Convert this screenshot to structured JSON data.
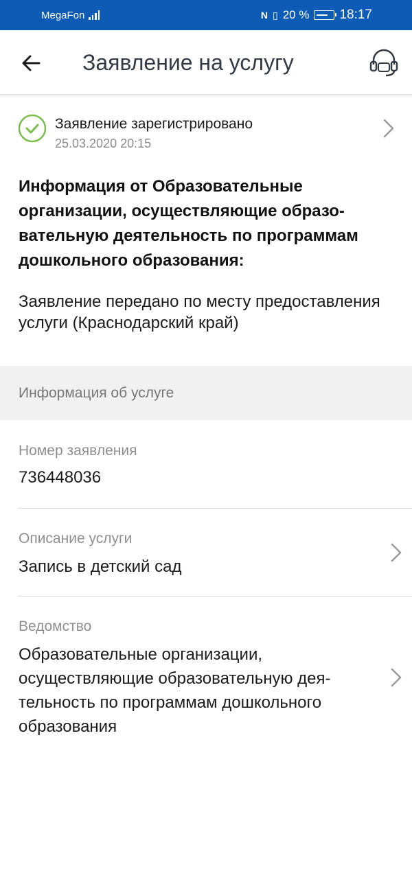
{
  "status_bar": {
    "carrier": "MegaFon",
    "battery_percent": "20 %",
    "time": "18:17"
  },
  "header": {
    "title": "Заявление на услугу"
  },
  "application_status": {
    "title": "Заявление зарегистрировано",
    "date": "25.03.2020 20:15",
    "accent_color": "#7cbf4e"
  },
  "info": {
    "heading": "Информация от Образовательные организации, осуществляющие образо­вательную деятельность по программам дошкольного образования:",
    "text": "Заявление передано по месту предоставления услуги (Краснодарский край)"
  },
  "section": {
    "title": "Информация об услуге"
  },
  "fields": [
    {
      "label": "Номер заявления",
      "value": "736448036"
    },
    {
      "label": "Описание услуги",
      "value": "Запись в детский сад"
    },
    {
      "label": "Ведомство",
      "value": "Образовательные организации, осуществляющие образовательную дея­тельность по программам дошкольного образования"
    }
  ],
  "colors": {
    "status_bar": "#0d5bb5",
    "section_band": "#f1f1f1"
  }
}
